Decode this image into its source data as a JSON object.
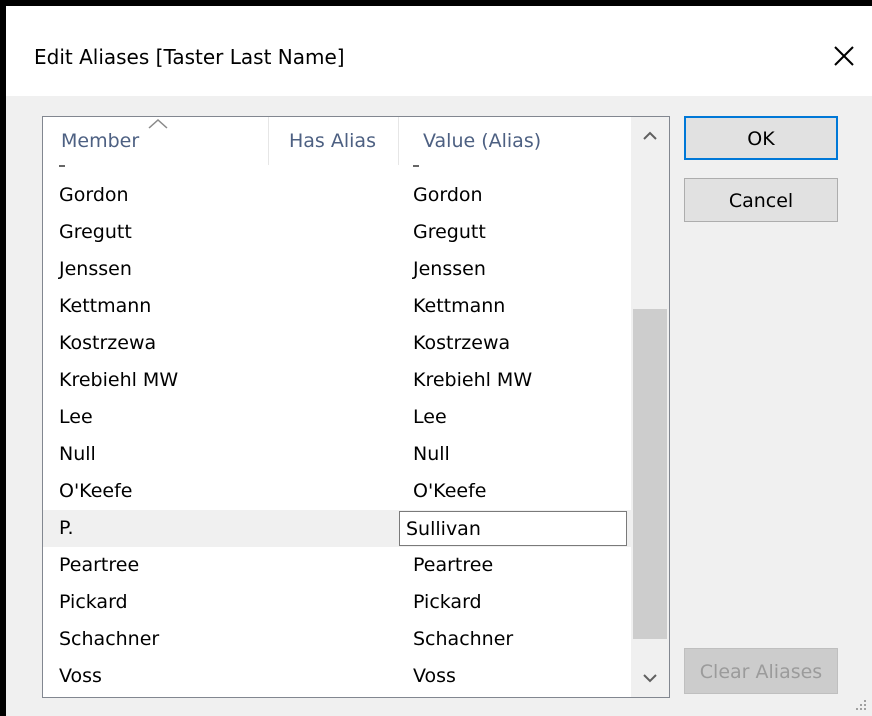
{
  "dialog": {
    "title": "Edit Aliases [Taster Last Name]"
  },
  "list": {
    "columns": {
      "member": "Member",
      "has_alias": "Has Alias",
      "value": "Value (Alias)"
    },
    "rows": [
      {
        "member": "Gordon",
        "has_alias": "",
        "alias": "Gordon"
      },
      {
        "member": "Gregutt",
        "has_alias": "",
        "alias": "Gregutt"
      },
      {
        "member": "Jenssen",
        "has_alias": "",
        "alias": "Jenssen"
      },
      {
        "member": "Kettmann",
        "has_alias": "",
        "alias": "Kettmann"
      },
      {
        "member": "Kostrzewa",
        "has_alias": "",
        "alias": "Kostrzewa"
      },
      {
        "member": "Krebiehl MW",
        "has_alias": "",
        "alias": "Krebiehl MW"
      },
      {
        "member": "Lee",
        "has_alias": "",
        "alias": "Lee"
      },
      {
        "member": "Null",
        "has_alias": "",
        "alias": "Null"
      },
      {
        "member": "O'Keefe",
        "has_alias": "",
        "alias": "O'Keefe"
      },
      {
        "member": "P.",
        "has_alias": "",
        "alias": "Sullivan",
        "selected": true,
        "editing": true
      },
      {
        "member": "Peartree",
        "has_alias": "",
        "alias": "Peartree"
      },
      {
        "member": "Pickard",
        "has_alias": "",
        "alias": "Pickard"
      },
      {
        "member": "Schachner",
        "has_alias": "",
        "alias": "Schachner"
      },
      {
        "member": "Voss",
        "has_alias": "",
        "alias": "Voss"
      }
    ],
    "sort_column": "member",
    "icons": {
      "sort": "sort-ascending-icon",
      "scroll_up": "chevron-up-icon",
      "scroll_down": "chevron-down-icon"
    }
  },
  "buttons": {
    "ok": "OK",
    "cancel": "Cancel",
    "clear_aliases": "Clear Aliases"
  },
  "colors": {
    "header_text": "#4d6082",
    "ok_border": "#0078d7",
    "dialog_bg": "#f0f0f0",
    "disabled_text": "#9b9b9b"
  },
  "icons": {
    "close": "close-icon",
    "resize": "resize-grip-icon"
  }
}
